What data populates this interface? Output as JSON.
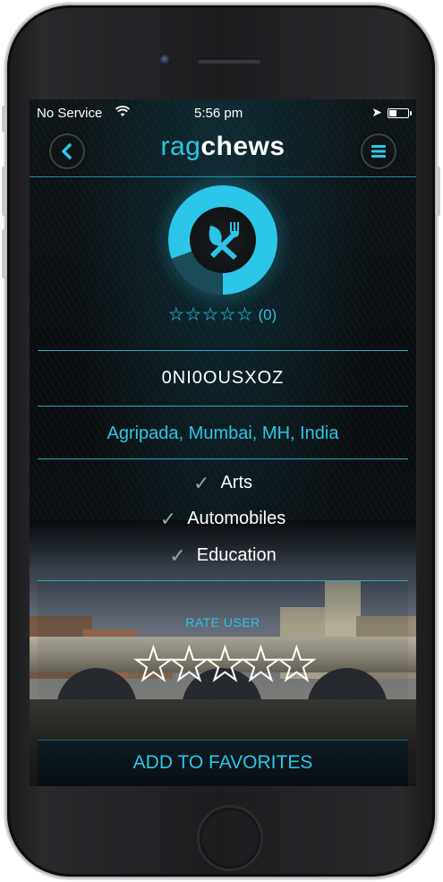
{
  "status_bar": {
    "carrier": "No Service",
    "time": "5:56 pm"
  },
  "nav": {
    "brand_prefix": "rag",
    "brand_suffix": "chews",
    "back_icon": "chevron-left-icon",
    "menu_icon": "hamburger-icon"
  },
  "profile": {
    "avatar_icon": "fork-knife-icon",
    "rating_stars": 0,
    "rating_count": "(0)",
    "username": "0NI0OUSXOZ",
    "location": "Agripada, Mumbai, MH, India"
  },
  "interests": [
    {
      "label": "Arts"
    },
    {
      "label": "Automobiles"
    },
    {
      "label": "Education"
    }
  ],
  "rate": {
    "label": "RATE USER",
    "stars": 0
  },
  "favorites_button": "ADD TO FAVORITES",
  "colors": {
    "accent": "#2cc6e8",
    "background": "#0b0f12",
    "text": "#ffffff"
  }
}
